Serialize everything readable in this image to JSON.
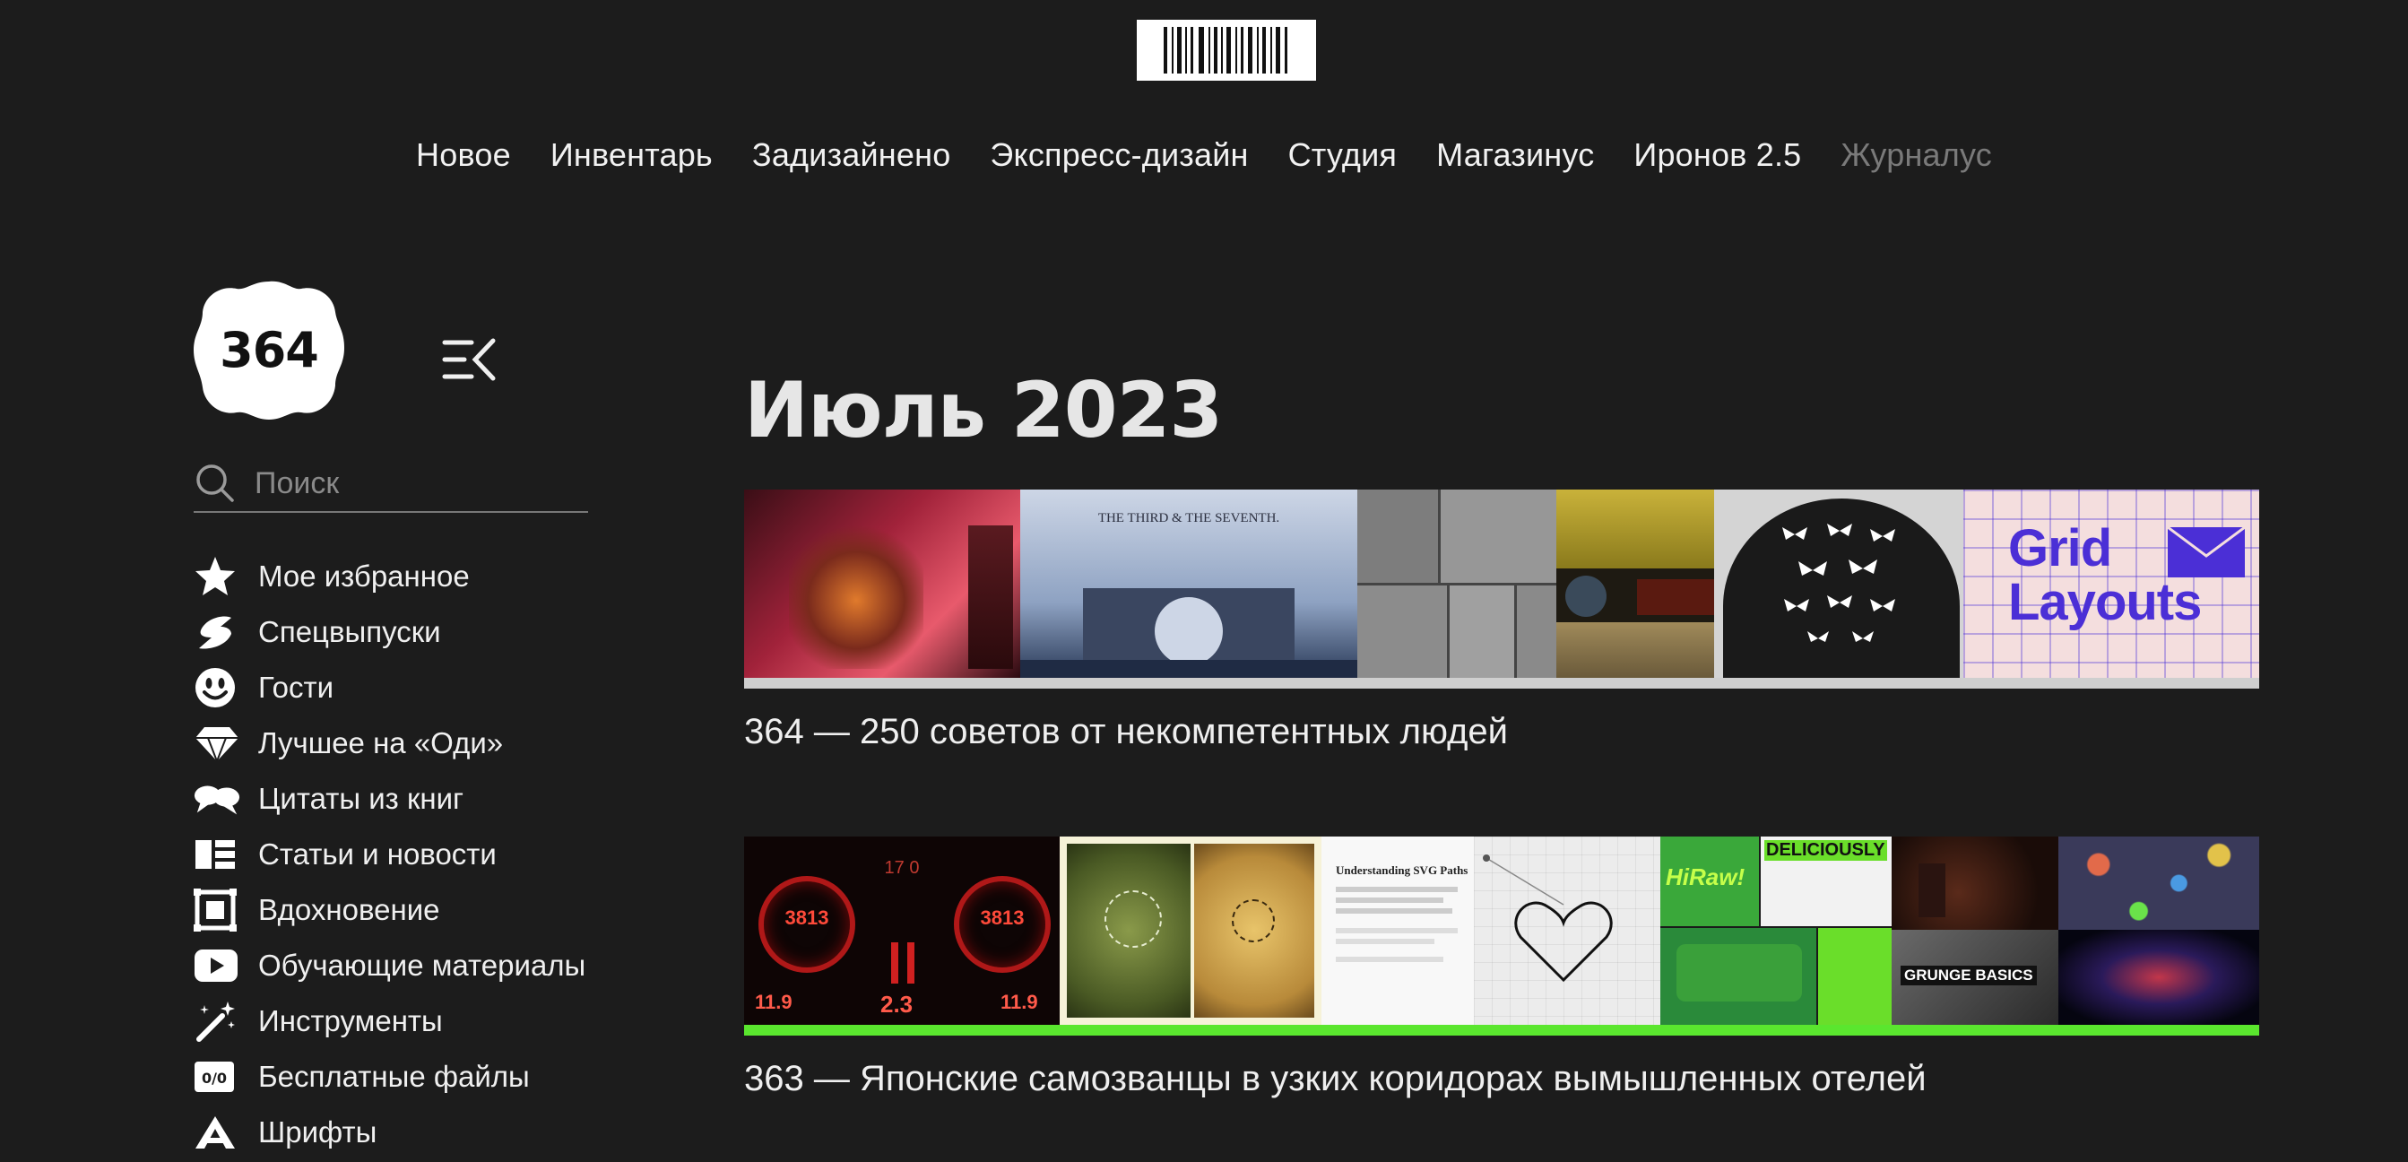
{
  "header": {
    "nav": [
      {
        "label": "Новое",
        "muted": false
      },
      {
        "label": "Инвентарь",
        "muted": false
      },
      {
        "label": "Задизайнено",
        "muted": false
      },
      {
        "label": "Экспресс-дизайн",
        "muted": false
      },
      {
        "label": "Студия",
        "muted": false
      },
      {
        "label": "Магазинус",
        "muted": false
      },
      {
        "label": "Иронов 2.5",
        "muted": false
      },
      {
        "label": "Журналус",
        "muted": true
      }
    ]
  },
  "logo": {
    "text": "364"
  },
  "search": {
    "placeholder": "Поиск"
  },
  "sidebar": {
    "items": [
      {
        "label": "Мое избранное",
        "icon": "star-icon"
      },
      {
        "label": "Спецвыпуски",
        "icon": "lightning-icon"
      },
      {
        "label": "Гости",
        "icon": "smiley-icon"
      },
      {
        "label": "Лучшее на «Оди»",
        "icon": "diamond-icon"
      },
      {
        "label": "Цитаты из книг",
        "icon": "quote-bubbles-icon"
      },
      {
        "label": "Статьи и новости",
        "icon": "article-icon"
      },
      {
        "label": "Вдохновение",
        "icon": "frame-icon"
      },
      {
        "label": "Обучающие материалы",
        "icon": "play-icon"
      },
      {
        "label": "Инструменты",
        "icon": "magic-wand-icon"
      },
      {
        "label": "Бесплатные файлы",
        "icon": "free-files-icon",
        "icon_text": "0/0"
      },
      {
        "label": "Шрифты",
        "icon": "font-icon"
      }
    ]
  },
  "main": {
    "month_title": "Июль 2023",
    "posts": [
      {
        "title": "364 — 250 советов от некомпетентных людей",
        "bar_color": "#cfcfcf",
        "tile_texts": {
          "film": "THE THIRD & THE SEVENTH.",
          "grid1": "Grid",
          "grid2": "Layouts"
        }
      },
      {
        "title": "363 — Японские самозванцы в узких коридорах вымышленных отелей",
        "bar_color": "#5ae62e",
        "tile_texts": {
          "gauge1": "3813",
          "gauge2": "3813",
          "val1": "11.9",
          "val2": "2.3",
          "val3": "11.9",
          "top": "17 0",
          "svg_title": "Understanding SVG Paths",
          "hiraw": "HiRaw!",
          "delicious": "DELICIOUSLY",
          "grunge": "GRUNGE BASICS"
        }
      }
    ]
  },
  "colors": {
    "background": "#1c1c1c",
    "text": "#efefef",
    "muted_nav": "#7a7a7a",
    "accent_green": "#5ae62e",
    "grid_purple": "#4b2fd6"
  }
}
